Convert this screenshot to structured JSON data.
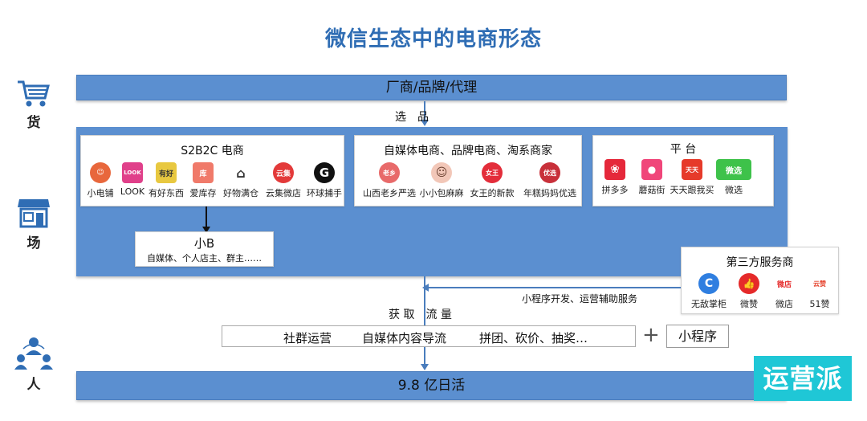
{
  "title": "微信生态中的电商形态",
  "side": {
    "goods": "货",
    "field": "场",
    "people": "人"
  },
  "top_bar": "厂商/品牌/代理",
  "select_label": "选　品",
  "s2b2c": {
    "title": "S2B2C 电商",
    "items": [
      {
        "name": "小电铺",
        "icon": "☺",
        "color": "#e8673c"
      },
      {
        "name": "LOOK",
        "icon": "LOOK",
        "color": "#e0408a"
      },
      {
        "name": "有好东西",
        "icon": "有好",
        "color": "#e8c840"
      },
      {
        "name": "爱库存",
        "icon": "库",
        "color": "#f07a6a"
      },
      {
        "name": "好物满仓",
        "icon": "⌂",
        "color": "#ffffff"
      },
      {
        "name": "云集微店",
        "icon": "云集",
        "color": "#e33a3a"
      },
      {
        "name": "环球捕手",
        "icon": "G",
        "color": "#111111"
      }
    ]
  },
  "smallb": {
    "title": "小B",
    "desc": "自媒体、个人店主、群主……"
  },
  "media": {
    "title": "自媒体电商、品牌电商、淘系商家",
    "items": [
      {
        "name": "山西老乡严选",
        "icon": "老乡",
        "color": "#e86a6a"
      },
      {
        "name": "小小包麻麻",
        "icon": "☺",
        "color": "#f2c7b8"
      },
      {
        "name": "女王的新款",
        "icon": "女王",
        "color": "#e32d3a"
      },
      {
        "name": "年糕妈妈优选",
        "icon": "优选",
        "color": "#c8303a"
      }
    ]
  },
  "platform": {
    "title": "平 台",
    "items": [
      {
        "name": "拼多多",
        "icon": "❀",
        "color": "#e5283a"
      },
      {
        "name": "蘑菇街",
        "icon": "●",
        "color": "#f0467a"
      },
      {
        "name": "天天跟我买",
        "icon": "天天",
        "color": "#e63a2a"
      },
      {
        "name": "微选",
        "icon": "微选",
        "color": "#3ec24a"
      }
    ]
  },
  "third_party": {
    "title": "第三方服务商",
    "items": [
      {
        "name": "无敌掌柜",
        "icon": "C",
        "color": "#2f7ee0"
      },
      {
        "name": "微赞",
        "icon": "👍",
        "color": "#e52a2a"
      },
      {
        "name": "微店",
        "icon": "微店",
        "color": "#ffffff"
      },
      {
        "name": "51赞",
        "icon": "云赞",
        "color": "#ffffff"
      }
    ]
  },
  "service_label": "小程序开发、运营辅助服务",
  "traffic_label": "获 取　流 量",
  "traffic_methods": [
    "社群运营",
    "自媒体内容导流",
    "拼团、砍价、抽奖…"
  ],
  "plus": "+",
  "mini_program": "小程序",
  "bottom_bar": "9.8 亿日活",
  "watermark": "运营派"
}
